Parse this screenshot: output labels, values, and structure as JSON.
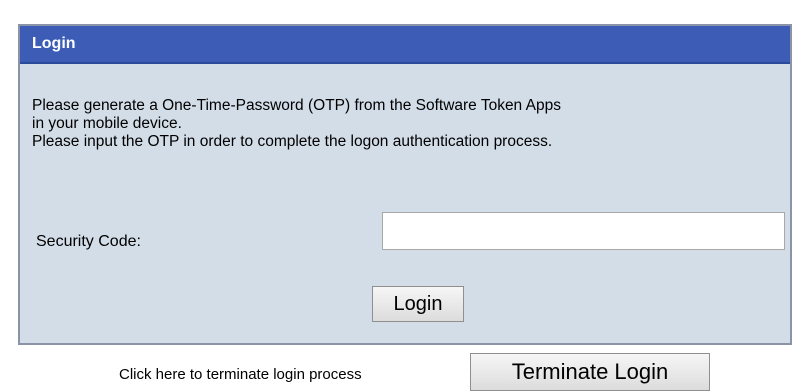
{
  "panel": {
    "title": "Login",
    "message_lines": [
      "Please generate a One-Time-Password (OTP) from the Software Token Apps",
      "in your mobile device.",
      "Please input the OTP in order to complete the logon authentication process."
    ],
    "security_code_label": "Security Code:",
    "security_code_value": "",
    "security_code_placeholder": "",
    "login_button": "Login"
  },
  "footer": {
    "terminate_text": "Click here to terminate login process",
    "terminate_button": "Terminate Login"
  },
  "colors": {
    "header_bg": "#3c5cb6",
    "panel_bg": "#d3dde8",
    "header_text": "#ffffff"
  }
}
